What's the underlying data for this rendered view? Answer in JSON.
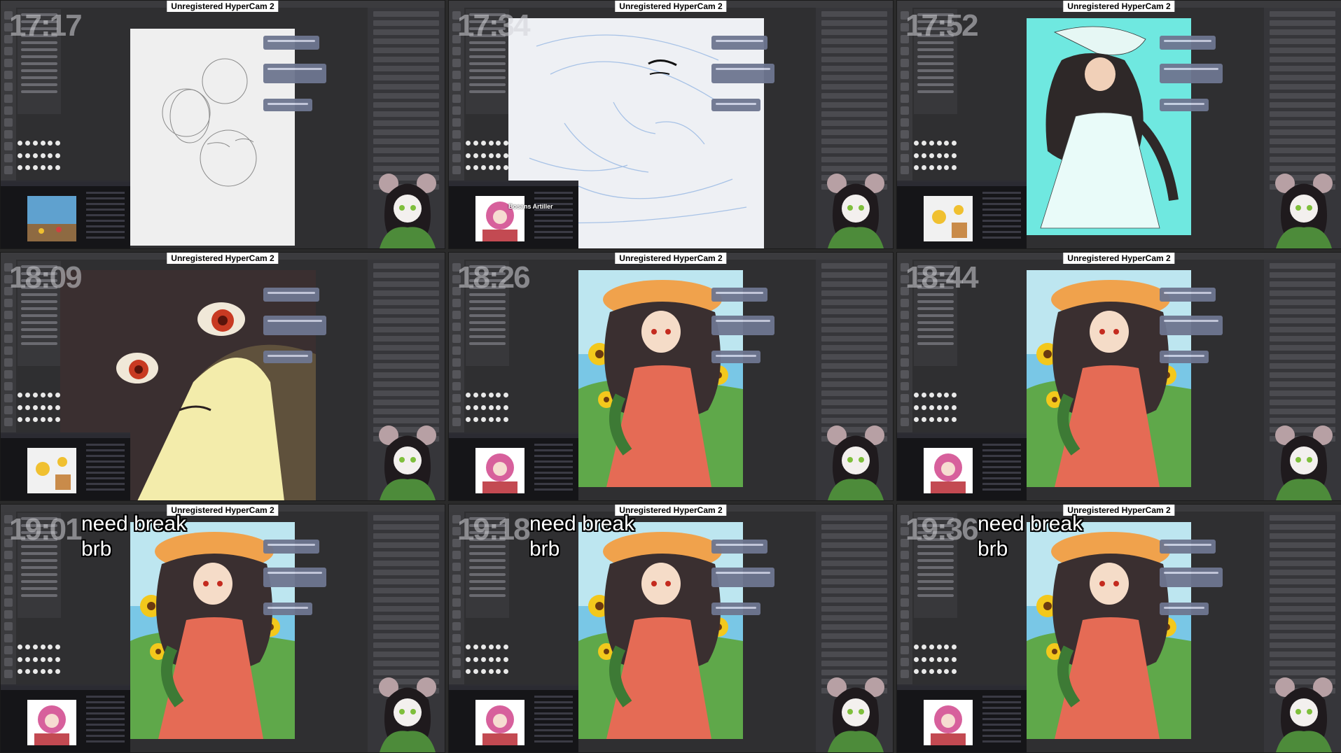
{
  "layout": {
    "columns": 3,
    "rows": 3
  },
  "watermark_text": "Unregistered HyperCam 2",
  "tiles": [
    {
      "clock": "17:17",
      "notice": "",
      "canvas": "sketch",
      "accent": "#d0d0d0"
    },
    {
      "clock": "17:34",
      "notice": "",
      "canvas": "lines",
      "accent": "#a7c2e6",
      "browser_text": "Bosans Artiller"
    },
    {
      "clock": "17:52",
      "notice": "",
      "canvas": "flat",
      "accent": "#6fe8e0"
    },
    {
      "clock": "18:09",
      "notice": "",
      "canvas": "closeup",
      "accent": "#e9e29a"
    },
    {
      "clock": "18:26",
      "notice": "",
      "canvas": "color",
      "accent": "#f1a07e"
    },
    {
      "clock": "18:44",
      "notice": "",
      "canvas": "color",
      "accent": "#f1a07e"
    },
    {
      "clock": "19:01",
      "notice": "need break\nbrb",
      "canvas": "final",
      "accent": "#f1a07e"
    },
    {
      "clock": "19:18",
      "notice": "need break\nbrb",
      "canvas": "final",
      "accent": "#f1a07e"
    },
    {
      "clock": "19:36",
      "notice": "need break\nbrb",
      "canvas": "final",
      "accent": "#f1a07e"
    }
  ],
  "colors": {
    "app_bg": "#2f2f31",
    "panel": "#36363a",
    "chat": "#6e7690",
    "sky": "#79c7e6",
    "sunflower": "#f3c81c",
    "dress": "#e56b55",
    "hair": "#3a2f30",
    "hat": "#f0a24c"
  },
  "icons": [
    "brush-icon",
    "eraser-icon",
    "layer-icon",
    "mouse-mascot-icon"
  ]
}
